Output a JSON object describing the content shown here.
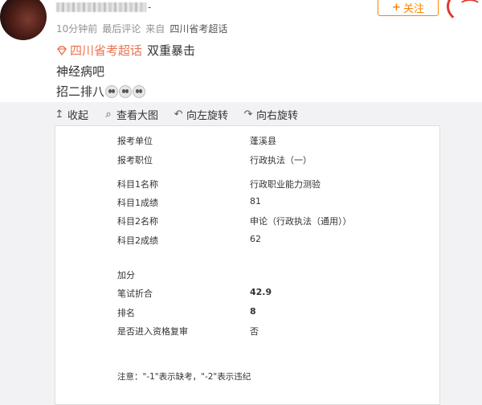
{
  "post": {
    "username_tail": "-",
    "time": "10分钟前",
    "last_comment": "最后评论",
    "from_label": "来自",
    "source": "四川省考超话",
    "follow_label": "关注",
    "topic": "四川省考超话",
    "line1_text": "双重暴击",
    "line2_text": "神经病吧",
    "line3_text": "招二排八"
  },
  "toolbar": {
    "collapse": "收起",
    "view_large": "查看大图",
    "rotate_left": "向左旋转",
    "rotate_right": "向右旋转"
  },
  "record": {
    "unit_label": "报考单位",
    "unit_value": "蓬溪县",
    "position_label": "报考职位",
    "position_value": "行政执法（一）",
    "subj1_name_label": "科目1名称",
    "subj1_name_value": "行政职业能力测验",
    "subj1_score_label": "科目1成绩",
    "subj1_score_value": "81",
    "subj2_name_label": "科目2名称",
    "subj2_name_value": "申论（行政执法（通用））",
    "subj2_score_label": "科目2成绩",
    "subj2_score_value": "62",
    "bonus_label": "加分",
    "written_label": "笔试折合",
    "written_value": "42.9",
    "rank_label": "排名",
    "rank_value": "8",
    "review_label": "是否进入资格复审",
    "review_value": "否",
    "note": "注意：\"-1\"表示缺考，\"-2\"表示违纪"
  },
  "colors": {
    "accent": "#ff8200",
    "topic": "#eb7350",
    "viewer_bg": "#f2f2f5"
  }
}
